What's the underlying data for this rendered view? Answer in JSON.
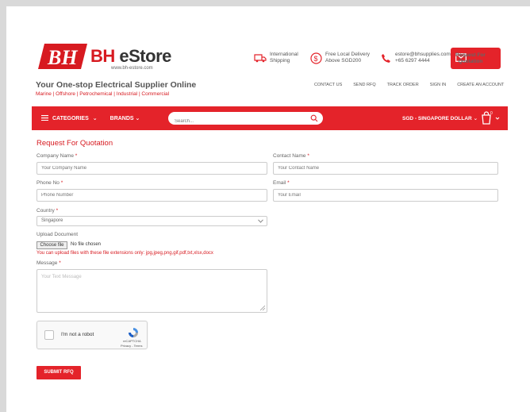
{
  "brand": {
    "name_part1": "BH",
    "name_part2": " eStore",
    "url": "www.bh-estore.com"
  },
  "header": {
    "shipping_line1": "International",
    "shipping_line2": "Shipping",
    "delivery_line1": "Free Local Delivery",
    "delivery_line2": "Above SGD200",
    "contact_email": "estore@bhsupplies.com",
    "contact_phone": "+65 6297 4444",
    "rfq_line1": "Request For",
    "rfq_line2": "Quotation",
    "tagline": "Your One-stop Electrical Supplier Online",
    "subtagline": "Marine | Offshore | Petrochemical | Industrial | Commercial",
    "links": [
      "CONTACT US",
      "SEND RFQ",
      "TRACK ORDER",
      "SIGN IN",
      "CREATE AN ACCOUNT"
    ]
  },
  "nav": {
    "categories": "CATEGORIES",
    "brands": "BRANDS",
    "search_placeholder": "Search...",
    "currency": "SGD - SINGAPORE DOLLAR",
    "cart_count": "0"
  },
  "form": {
    "title": "Request For Quotation",
    "company_label": "Company Name",
    "company_placeholder": "Your Company Name",
    "contact_label": "Contact Name",
    "contact_placeholder": "Your Contact Name",
    "phone_label": "Phone No",
    "phone_placeholder": "Phone Number",
    "email_label": "Email",
    "email_placeholder": "Your Email",
    "country_label": "Country",
    "country_value": "Singapore",
    "upload_label": "Upload Document",
    "choose_file": "Choose file",
    "no_file": "No file chosen",
    "upload_hint": "You can upload files with these file extensions only: jpg,jpeg,png,gif,pdf,txt,xlsx,docx",
    "message_label": "Message",
    "message_placeholder": "Your Text Message",
    "captcha_text": "I'm not a robot",
    "captcha_brand": "reCAPTCHA",
    "captcha_terms": "Privacy - Terms",
    "submit": "SUBMIT RFQ",
    "required_mark": "*"
  },
  "colors": {
    "accent": "#e4232a",
    "title": "#d71a20"
  }
}
